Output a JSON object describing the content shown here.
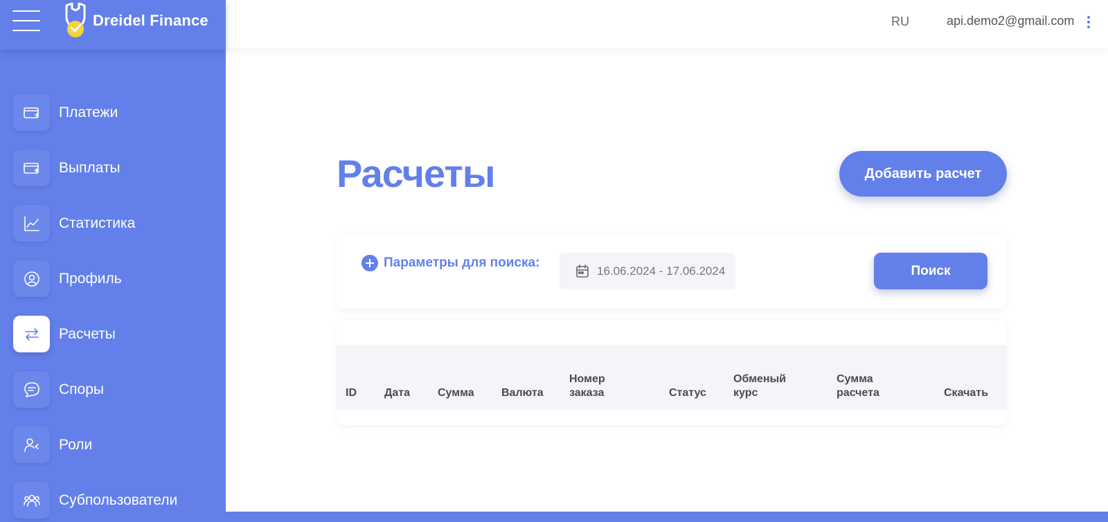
{
  "app": {
    "name": "Dreidel Finance",
    "brand_color": "#6380ea",
    "accent_color": "#f5d33a"
  },
  "topbar": {
    "language": "RU",
    "user_email": "api.demo2@gmail.com"
  },
  "sidebar": {
    "items": [
      {
        "label": "Платежи",
        "icon": "wallet-in-icon",
        "active": false
      },
      {
        "label": "Выплаты",
        "icon": "wallet-out-icon",
        "active": false
      },
      {
        "label": "Статистика",
        "icon": "chart-line-icon",
        "active": false
      },
      {
        "label": "Профиль",
        "icon": "user-circle-icon",
        "active": false
      },
      {
        "label": "Расчеты",
        "icon": "transfer-arrows-icon",
        "active": true
      },
      {
        "label": "Споры",
        "icon": "chat-bubble-icon",
        "active": false
      },
      {
        "label": "Роли",
        "icon": "user-roles-icon",
        "active": false
      },
      {
        "label": "Субпользователи",
        "icon": "users-group-icon",
        "active": false
      }
    ]
  },
  "main": {
    "title": "Расчеты",
    "add_button": "Добавить расчет",
    "search": {
      "params_label": "Параметры для поиска:",
      "date_range": "16.06.2024 - 17.06.2024",
      "button": "Поиск"
    },
    "table": {
      "columns": [
        [
          "ID"
        ],
        [
          "Дата"
        ],
        [
          "Сумма"
        ],
        [
          "Валюта"
        ],
        [
          "Номер",
          "заказа"
        ],
        [
          "Статус"
        ],
        [
          "Обменый",
          "курс"
        ],
        [
          "Сумма",
          "расчета"
        ],
        [
          "Скачать"
        ]
      ],
      "rows": []
    }
  }
}
